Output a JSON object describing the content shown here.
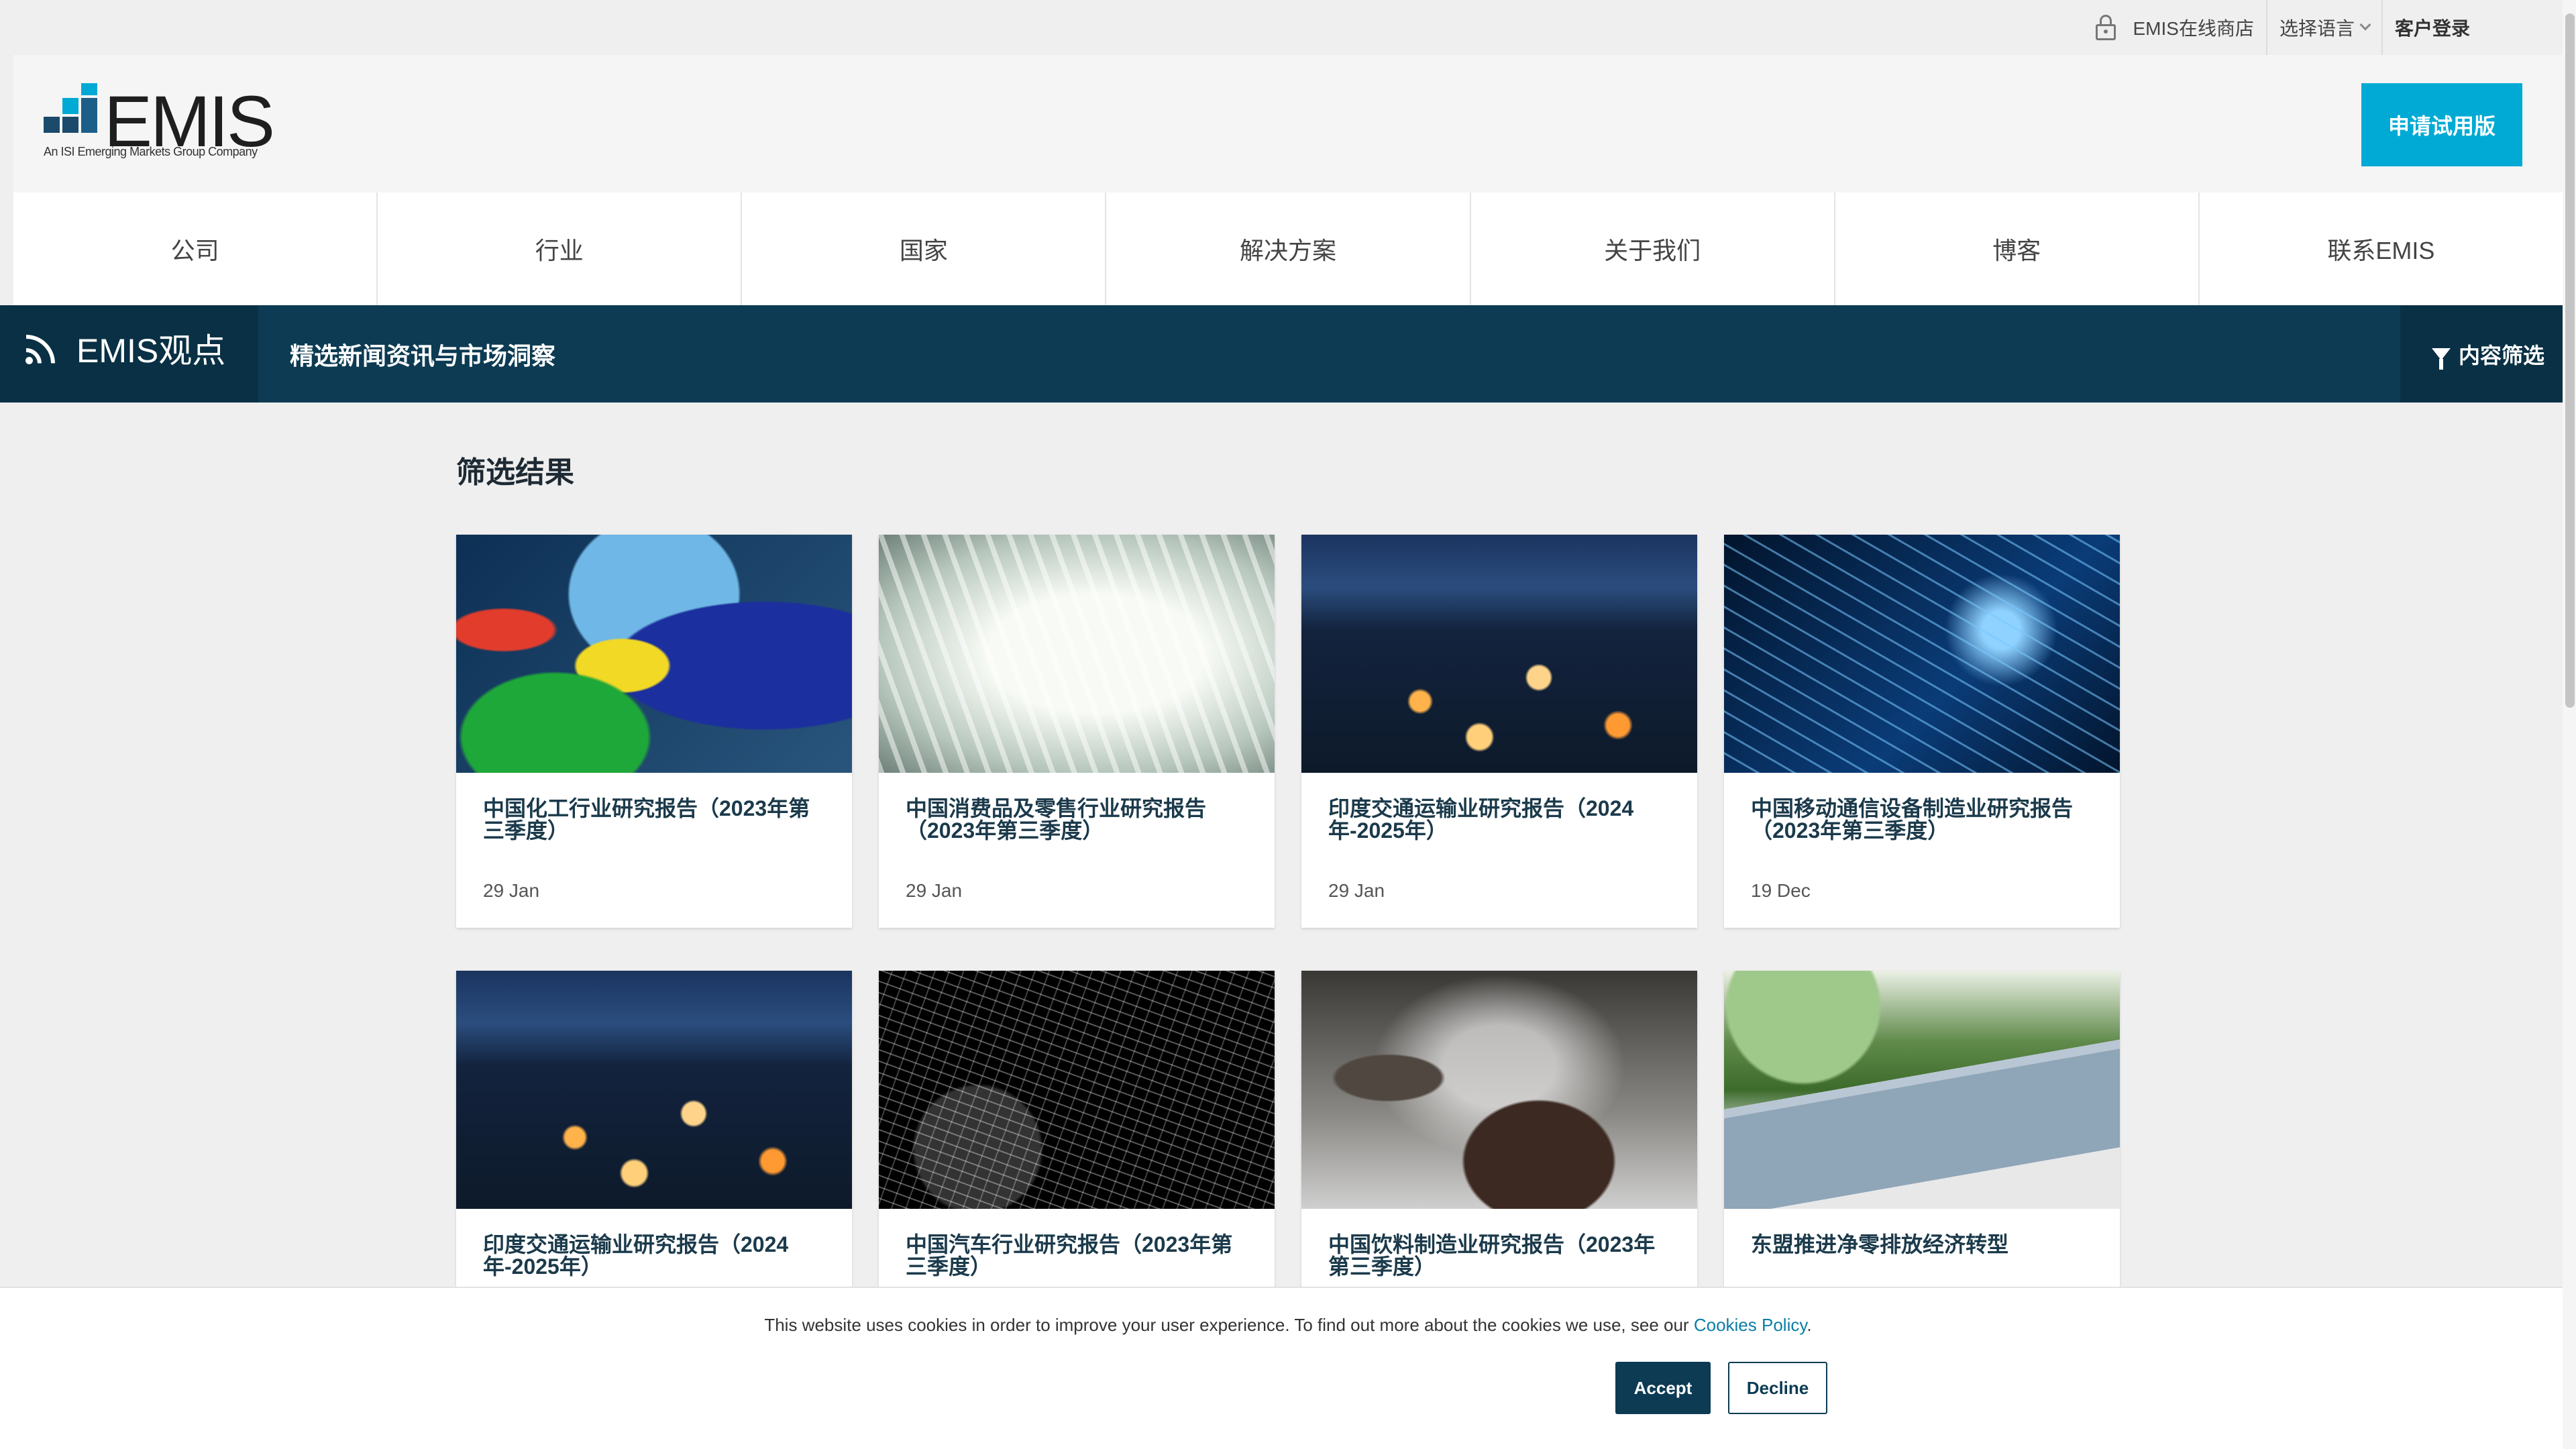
{
  "topbar": {
    "store_label": "EMIS在线商店",
    "language_label": "选择语言",
    "login_label": "客户登录"
  },
  "header": {
    "logo_text": "EMIS",
    "logo_subtitle": "An ISI Emerging Markets Group Company",
    "trial_button": "申请试用版"
  },
  "nav": {
    "items": [
      "公司",
      "行业",
      "国家",
      "解决方案",
      "关于我们",
      "博客",
      "联系EMIS"
    ]
  },
  "insights_bar": {
    "title": "EMIS观点",
    "subtitle": "精选新闻资讯与市场洞察",
    "filter_label": "内容筛选"
  },
  "results": {
    "title": "筛选结果",
    "cards": [
      {
        "title": "中国化工行业研究报告（2023年第三季度）",
        "date": "29 Jan",
        "image": "plastic-bottles"
      },
      {
        "title": "中国消费品及零售行业研究报告（2023年第三季度）",
        "date": "29 Jan",
        "image": "shopping-mall-atrium"
      },
      {
        "title": "印度交通运输业研究报告（2024年-2025年）",
        "date": "29 Jan",
        "image": "city-night-skyline"
      },
      {
        "title": "中国移动通信设备制造业研究报告（2023年第三季度）",
        "date": "19 Dec",
        "image": "fiber-optic-lights"
      },
      {
        "title": "印度交通运输业研究报告（2024年-2025年）",
        "date": "",
        "image": "city-night-skyline"
      },
      {
        "title": "中国汽车行业研究报告（2023年第三季度）",
        "date": "",
        "image": "car-wireframe"
      },
      {
        "title": "中国饮料制造业研究报告（2023年第三季度）",
        "date": "",
        "image": "tea-cups-steam"
      },
      {
        "title": "东盟推进净零排放经济转型",
        "date": "",
        "image": "solar-panels-forest"
      }
    ]
  },
  "cookie_banner": {
    "text": "This website uses cookies in order to improve your user experience. To find out more about the cookies we use, see our",
    "link": "Cookies Policy",
    "period": ".",
    "accept": "Accept",
    "decline": "Decline"
  },
  "colors": {
    "accent": "#00aad4",
    "navy": "#0c3b53",
    "link": "#0a7ea6"
  }
}
